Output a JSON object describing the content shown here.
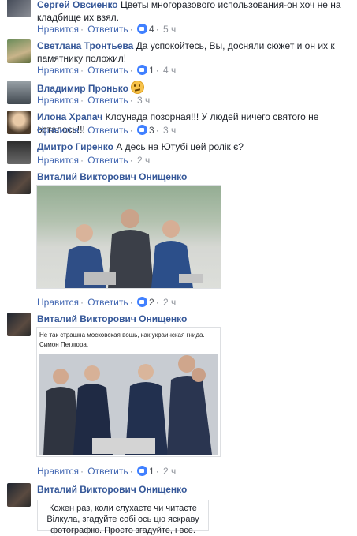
{
  "comments": [
    {
      "name": "Сергей Овсиенко",
      "text": "Цветы многоразового использования-он хоч не на",
      "text2": "кладбище их взял."
    },
    {
      "name": "Светлана Тронтьева",
      "text": "Да успокойтесь, Вы, досняли сюжет и он их к",
      "text2": "памятнику положил!"
    },
    {
      "name": "Владимир Пронько",
      "text": ""
    },
    {
      "name": "Илона Храпач",
      "text": "Клоунада позорная!!! У людей ничего святого не осталось!!!"
    },
    {
      "name": "Дмитро Гиренко",
      "text": "А десь на Ютубі цей ролік є?"
    },
    {
      "name": "Виталий Викторович Онищенко",
      "text": ""
    },
    {
      "name": "Виталий Викторович Онищенко",
      "text": ""
    },
    {
      "name": "Виталий Викторович Онищенко",
      "text": ""
    }
  ],
  "actions": {
    "like": "Нравится",
    "reply": "Ответить",
    "sep": "·",
    "r1": {
      "count": "4",
      "time": "5 ч"
    },
    "r2": {
      "count": "1",
      "time": "4 ч"
    },
    "r3": {
      "time": "3 ч"
    },
    "r4": {
      "count": "3",
      "time": "3 ч"
    },
    "r5": {
      "time": "2 ч"
    },
    "r6": {
      "count": "2",
      "time": "2 ч"
    },
    "r7": {
      "count": "1",
      "time": "2 ч"
    }
  },
  "photo2": {
    "caption1": "Не так страшна московская вошь, как украинская гнида.",
    "caption2": "Симон Петлюра."
  },
  "card": {
    "line1": "Кожен раз, коли слухаєте чи читаєте",
    "line2": "Вілкула, згадуйте собі ось цю яскраву",
    "line3": "фотографію. Просто згадуйте, і все."
  },
  "colors": {
    "link": "#4267b2",
    "name": "#365899",
    "meta": "#90949c",
    "reaction": "#4080ff"
  }
}
